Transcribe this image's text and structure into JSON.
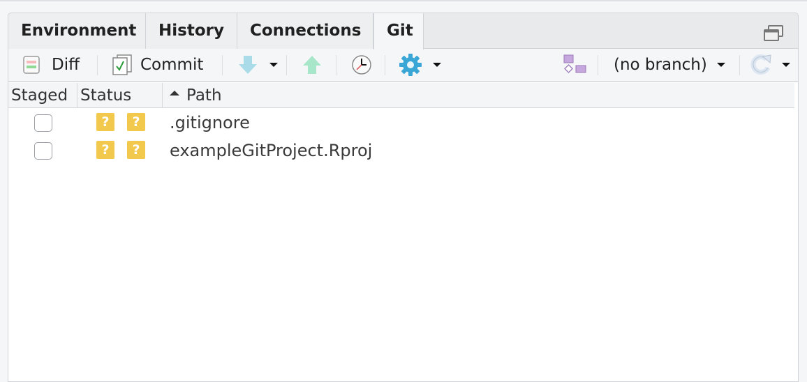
{
  "tabs": [
    {
      "label": "Environment",
      "active": false
    },
    {
      "label": "History",
      "active": false
    },
    {
      "label": "Connections",
      "active": false
    },
    {
      "label": "Git",
      "active": true
    }
  ],
  "toolbar": {
    "diff_label": "Diff",
    "commit_label": "Commit",
    "pull_icon": "arrow-down-icon",
    "push_icon": "arrow-up-icon",
    "history_icon": "clock-icon",
    "more_icon": "gear-icon",
    "branch_icon": "branch-graph-icon",
    "branch_label": "(no branch)",
    "refresh_icon": "refresh-icon"
  },
  "table": {
    "columns": [
      "Staged",
      "Status",
      "Path"
    ],
    "sort_column": "Path",
    "sort_direction": "ascending",
    "rows": [
      {
        "staged": false,
        "status": [
          "?",
          "?"
        ],
        "path": ".gitignore"
      },
      {
        "staged": false,
        "status": [
          "?",
          "?"
        ],
        "path": "exampleGitProject.Rproj"
      }
    ]
  },
  "colors": {
    "untracked_badge": "#f2c94c",
    "pull_arrow": "#a9dbe8",
    "push_arrow": "#a8e6c9",
    "gear": "#3aa6d6",
    "branch": "#c7a8de"
  }
}
